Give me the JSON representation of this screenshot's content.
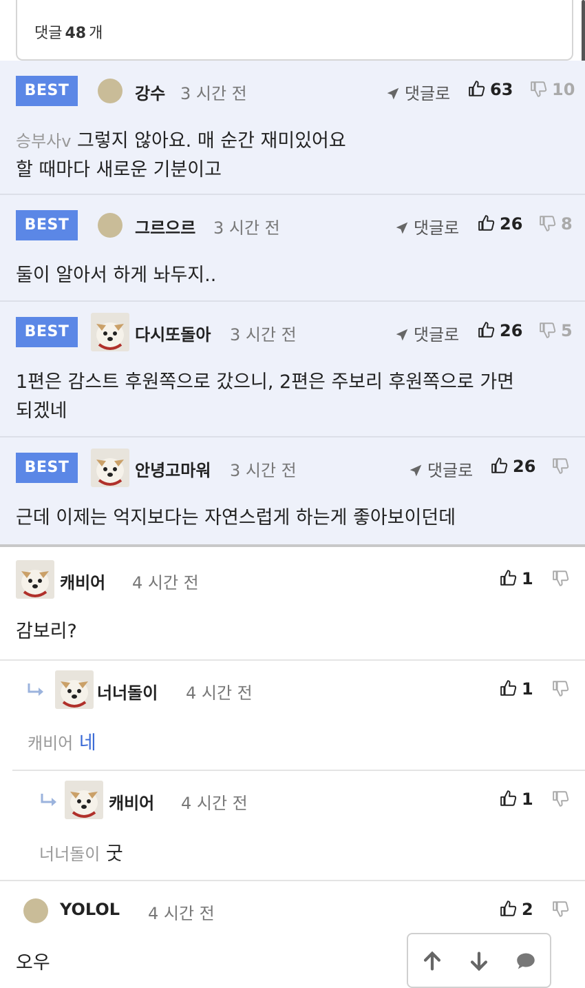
{
  "header": {
    "prefix": "댓글",
    "count": "48",
    "suffix": "개"
  },
  "best": [
    {
      "badge": "BEST",
      "name": "강수",
      "time": "3 시간 전",
      "reply": "댓글로",
      "up": "63",
      "down": "10",
      "mention": "승부사v",
      "line1": "그렇지 않아요. 매 순간 재미있어요",
      "line2": "할 때마다 새로운 기분이고"
    },
    {
      "badge": "BEST",
      "name": "그르으르",
      "time": "3 시간 전",
      "reply": "댓글로",
      "up": "26",
      "down": "8",
      "line1": "둘이 알아서 하게 놔두지.."
    },
    {
      "badge": "BEST",
      "name": "다시또돌아",
      "time": "3 시간 전",
      "reply": "댓글로",
      "up": "26",
      "down": "5",
      "line1": "1편은 감스트 후원쪽으로 갔으니, 2편은 주보리 후원쪽으로 가면",
      "line2": "되겠네"
    },
    {
      "badge": "BEST",
      "name": "안녕고마워",
      "time": "3 시간 전",
      "reply": "댓글로",
      "up": "26",
      "down": "",
      "line1": "근데 이제는 억지보다는 자연스럽게 하는게 좋아보이던데"
    }
  ],
  "comments": [
    {
      "name": "캐비어",
      "time": "4 시간 전",
      "up": "1",
      "text": "감보리?"
    },
    {
      "name": "너너돌이",
      "time": "4 시간 전",
      "up": "1",
      "mention": "캐비어",
      "text": "네"
    },
    {
      "name": "캐비어",
      "time": "4 시간 전",
      "up": "1",
      "mention": "너너돌이",
      "text": "굿"
    },
    {
      "name": "YOLOL",
      "time": "4 시간 전",
      "up": "2",
      "text": "오우"
    }
  ],
  "colors": {
    "best_bg": "#eef1fa",
    "badge": "#5b87e6",
    "link": "#3a6ad6"
  },
  "icons": [
    "paper-plane-icon",
    "thumbs-up-icon",
    "thumbs-down-icon",
    "reply-arrow-icon",
    "arrow-up-icon",
    "arrow-down-icon",
    "chat-bubble-icon"
  ]
}
